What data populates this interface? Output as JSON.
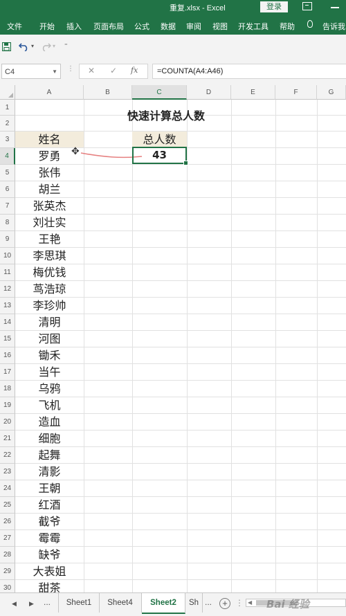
{
  "window": {
    "title": "重复.xlsx  -  Excel",
    "login_label": "登录"
  },
  "ribbon_tabs": [
    "文件",
    "开始",
    "插入",
    "页面布局",
    "公式",
    "数据",
    "审阅",
    "视图",
    "开发工具",
    "帮助",
    "告诉我"
  ],
  "formula_bar": {
    "name_box": "C4",
    "formula": "=COUNTA(A4:A46)",
    "fx_label": "fx"
  },
  "columns": [
    "A",
    "B",
    "C",
    "D",
    "E",
    "F",
    "G"
  ],
  "rows": [
    "1",
    "2",
    "3",
    "4",
    "5",
    "6",
    "7",
    "8",
    "9",
    "10",
    "11",
    "12",
    "13",
    "14",
    "15",
    "16",
    "17",
    "18",
    "19",
    "20",
    "21",
    "22",
    "23",
    "24",
    "25",
    "26",
    "27",
    "28",
    "29",
    "30"
  ],
  "sheet": {
    "title": "快速计算总人数",
    "col_a_header": "姓名",
    "col_c_header": "总人数",
    "total_value": "43",
    "names": [
      "罗勇",
      "张伟",
      "胡兰",
      "张英杰",
      "刘壮实",
      "王艳",
      "李思琪",
      "梅优钱",
      "茑浩琼",
      "李珍帅",
      "清明",
      "河图",
      "锄禾",
      "当午",
      "乌鸦",
      "飞机",
      "造血",
      "细胞",
      "起舞",
      "清影",
      "王朝",
      "红酒",
      "截爷",
      "霉霉",
      "缺爷",
      "大表姐",
      "甜茶"
    ]
  },
  "sheet_tabs": {
    "items": [
      "Sheet1",
      "Sheet4",
      "Sheet2",
      "Sh"
    ],
    "active": "Sheet2",
    "more_label": "...",
    "more_right_label": "..."
  },
  "watermark": "Bai 经验",
  "colors": {
    "excel_green": "#217346",
    "header_fill": "#f3ecdc"
  }
}
